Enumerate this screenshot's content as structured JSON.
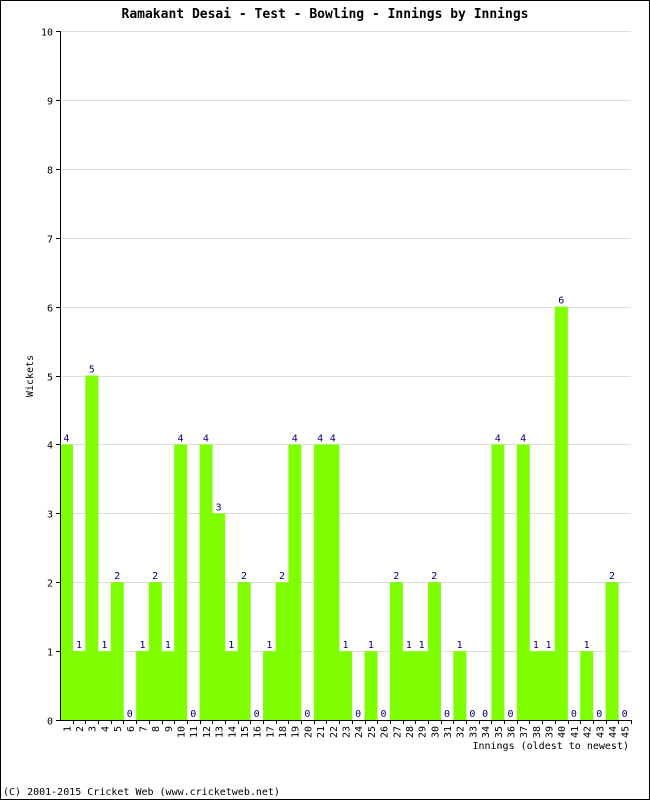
{
  "chart_data": {
    "type": "bar",
    "title": "Ramakant Desai - Test - Bowling - Innings by Innings",
    "xlabel": "Innings (oldest to newest)",
    "ylabel": "Wickets",
    "ylim": [
      0,
      10
    ],
    "yticks": [
      "0",
      "1",
      "2",
      "3",
      "4",
      "5",
      "6",
      "7",
      "8",
      "9",
      "10"
    ],
    "grid": true,
    "legend": "none",
    "bar_color": "#80ff00",
    "label_color": "#000080",
    "categories": [
      "1",
      "2",
      "3",
      "4",
      "5",
      "6",
      "7",
      "8",
      "9",
      "10",
      "11",
      "12",
      "13",
      "14",
      "15",
      "16",
      "17",
      "18",
      "19",
      "20",
      "21",
      "22",
      "23",
      "24",
      "25",
      "26",
      "27",
      "28",
      "29",
      "30",
      "31",
      "32",
      "33",
      "34",
      "35",
      "36",
      "37",
      "38",
      "39",
      "40",
      "41",
      "42",
      "43",
      "44",
      "45"
    ],
    "values": [
      4,
      1,
      5,
      1,
      2,
      0,
      1,
      2,
      1,
      4,
      0,
      4,
      3,
      1,
      2,
      0,
      1,
      2,
      4,
      0,
      4,
      4,
      1,
      0,
      1,
      0,
      2,
      1,
      1,
      2,
      0,
      1,
      0,
      0,
      4,
      0,
      4,
      1,
      1,
      6,
      0,
      1,
      0,
      2,
      0
    ]
  },
  "footer": {
    "copyright": "(C) 2001-2015 Cricket Web (www.cricketweb.net)"
  }
}
